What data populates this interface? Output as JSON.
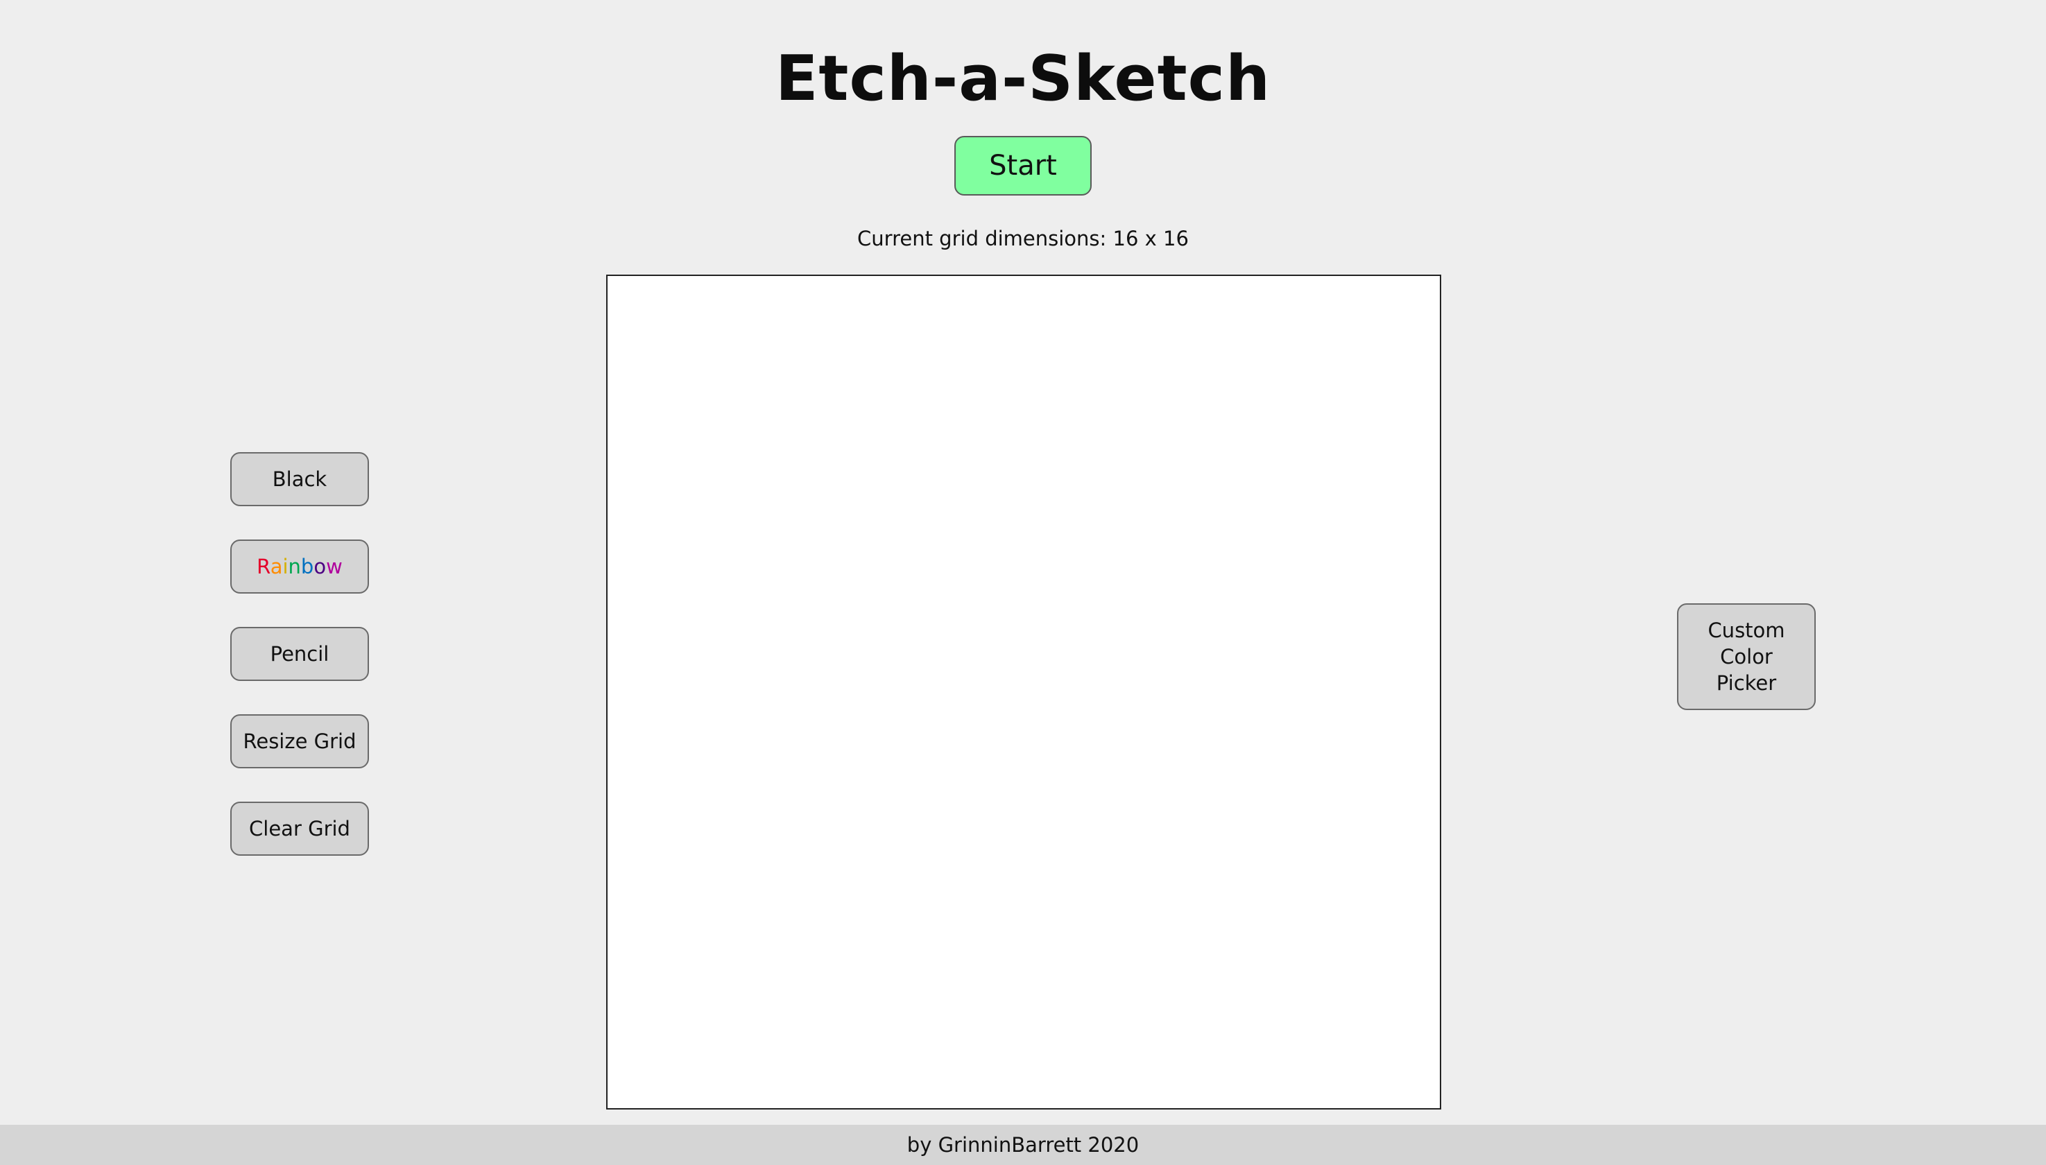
{
  "header": {
    "title": "Etch-a-Sketch",
    "start_label": "Start",
    "dimensions_text": "Current grid dimensions: 16 x 16"
  },
  "grid": {
    "rows": 16,
    "columns": 16,
    "background": "#ffffff"
  },
  "tools": {
    "black_label": "Black",
    "rainbow_label": "Rainbow",
    "rainbow_colors": [
      "#e4002b",
      "#ff8c00",
      "#d4b000",
      "#00a650",
      "#0070c0",
      "#4b0082",
      "#b0009c"
    ],
    "pencil_label": "Pencil",
    "resize_label": "Resize Grid",
    "clear_label": "Clear Grid"
  },
  "custom_picker": {
    "lines": [
      "Custom",
      "Color",
      "Picker"
    ]
  },
  "footer": {
    "credit": "by GrinninBarrett 2020"
  },
  "colors": {
    "background": "#eeeeee",
    "start_button": "#80ff9f",
    "tool_button": "#d5d5d5",
    "footer": "#d5d5d5"
  }
}
